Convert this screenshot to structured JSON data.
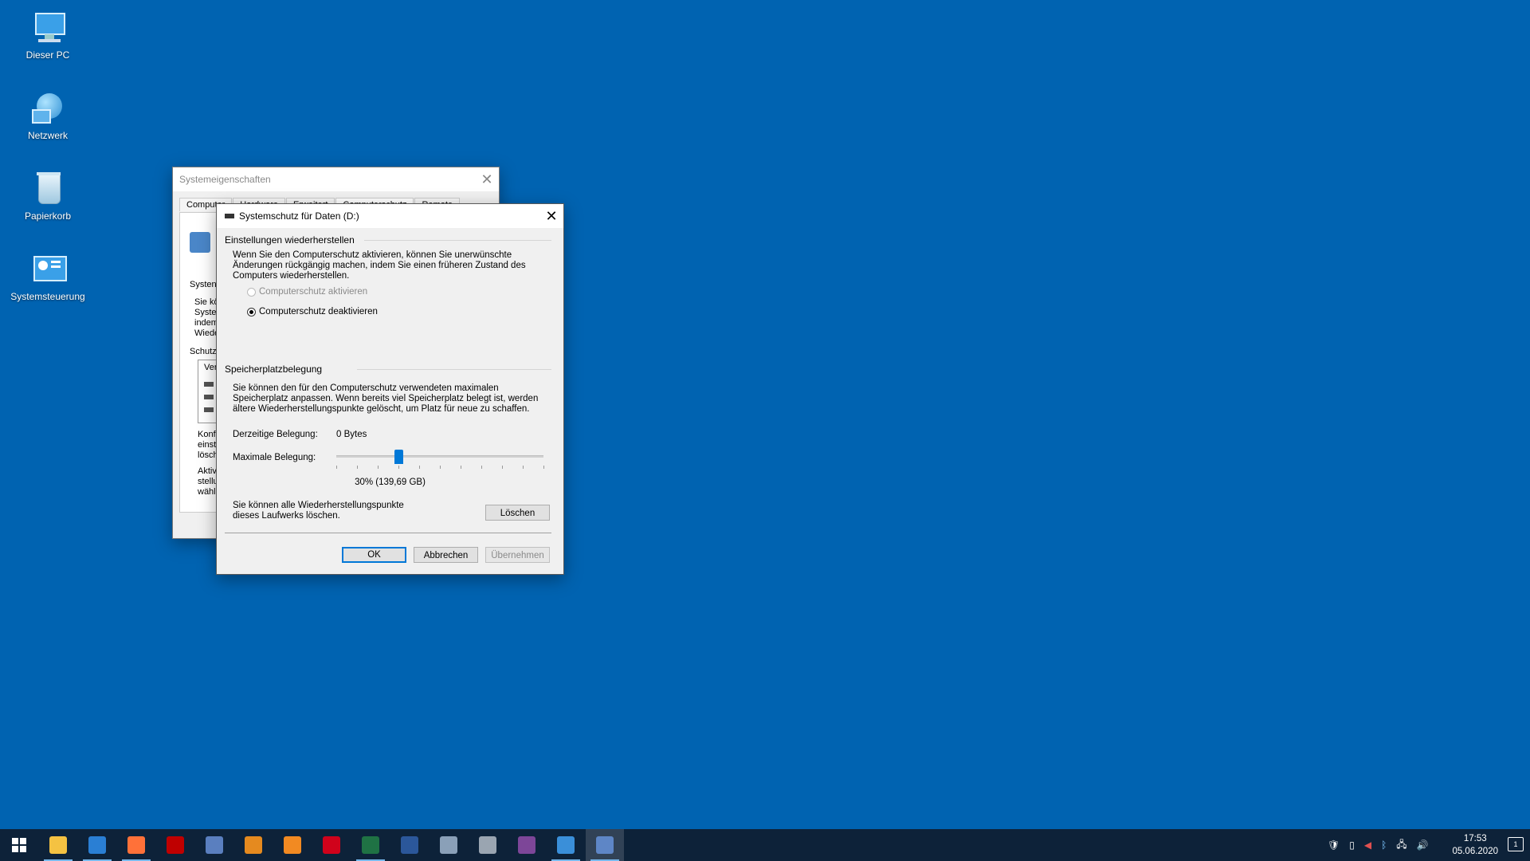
{
  "desktop": {
    "icons": [
      {
        "label": "Dieser PC",
        "icon": "computer-icon"
      },
      {
        "label": "Netzwerk",
        "icon": "network-icon"
      },
      {
        "label": "Papierkorb",
        "icon": "recycle-bin-icon"
      },
      {
        "label": "Systemsteuerung",
        "icon": "control-panel-icon"
      }
    ]
  },
  "back_window": {
    "title": "Systemeigenschaften",
    "tabs": [
      "Computer",
      "Hardware",
      "Erweitert",
      "Computerschutz",
      "Remote"
    ],
    "fragments": [
      "Systen",
      "Sie kö",
      "Systen",
      "indem",
      "Wiede",
      "Schutz",
      "Ver",
      "Konfi",
      "einste",
      "lösch",
      "Aktiv",
      "stellu",
      "wähle"
    ]
  },
  "dialog": {
    "title": "Systemschutz für Daten (D:)",
    "restore_group": "Einstellungen wiederherstellen",
    "restore_text": "Wenn Sie den Computerschutz aktivieren, können Sie unerwünschte Änderungen rückgängig machen, indem Sie einen früheren Zustand des Computers wiederherstellen.",
    "radio_enable": "Computerschutz aktivieren",
    "radio_disable": "Computerschutz deaktivieren",
    "radio_selected": "disable",
    "usage_group": "Speicherplatzbelegung",
    "usage_text": "Sie können den für den Computerschutz verwendeten maximalen Speicherplatz anpassen. Wenn bereits viel Speicherplatz belegt ist, werden ältere Wiederherstellungspunkte gelöscht, um Platz für neue zu schaffen.",
    "current_label": "Derzeitige Belegung:",
    "current_value": "0 Bytes",
    "max_label": "Maximale Belegung:",
    "max_percent": 30,
    "max_value_text": "30% (139,69 GB)",
    "delete_text": "Sie können alle Wiederherstellungspunkte dieses Laufwerks löschen.",
    "delete_button": "Löschen",
    "ok_button": "OK",
    "cancel_button": "Abbrechen",
    "apply_button": "Übernehmen"
  },
  "taskbar": {
    "apps": [
      {
        "name": "start",
        "icon": "windows-logo-icon",
        "color": "#ffffff"
      },
      {
        "name": "explorer",
        "icon": "folder-icon",
        "color": "#f4c242"
      },
      {
        "name": "thunderbird",
        "icon": "mail-icon",
        "color": "#2a7fd4"
      },
      {
        "name": "firefox",
        "icon": "firefox-icon",
        "color": "#ff7139"
      },
      {
        "name": "filezilla",
        "icon": "filezilla-icon",
        "color": "#bf0000"
      },
      {
        "name": "network-tool",
        "icon": "network-tool-icon",
        "color": "#5a7fbf"
      },
      {
        "name": "app-orange",
        "icon": "app-orange-icon",
        "color": "#e58a1f"
      },
      {
        "name": "rss",
        "icon": "rss-icon",
        "color": "#f28a22"
      },
      {
        "name": "sky-go",
        "icon": "sky-go-icon",
        "color": "#d0021b"
      },
      {
        "name": "excel",
        "icon": "excel-icon",
        "color": "#1f7244"
      },
      {
        "name": "word",
        "icon": "word-icon",
        "color": "#2b579a"
      },
      {
        "name": "security",
        "icon": "shield-app-icon",
        "color": "#8aa0b8"
      },
      {
        "name": "app-gray",
        "icon": "app-gray-icon",
        "color": "#9aa5b1"
      },
      {
        "name": "tor",
        "icon": "tor-icon",
        "color": "#7d4698"
      },
      {
        "name": "control-panel",
        "icon": "control-panel-task-icon",
        "color": "#3a8fd9"
      },
      {
        "name": "system-props",
        "icon": "system-properties-task-icon",
        "color": "#5e86c6"
      }
    ],
    "time": "17:53",
    "date": "05.06.2020",
    "notification_count": "1"
  }
}
